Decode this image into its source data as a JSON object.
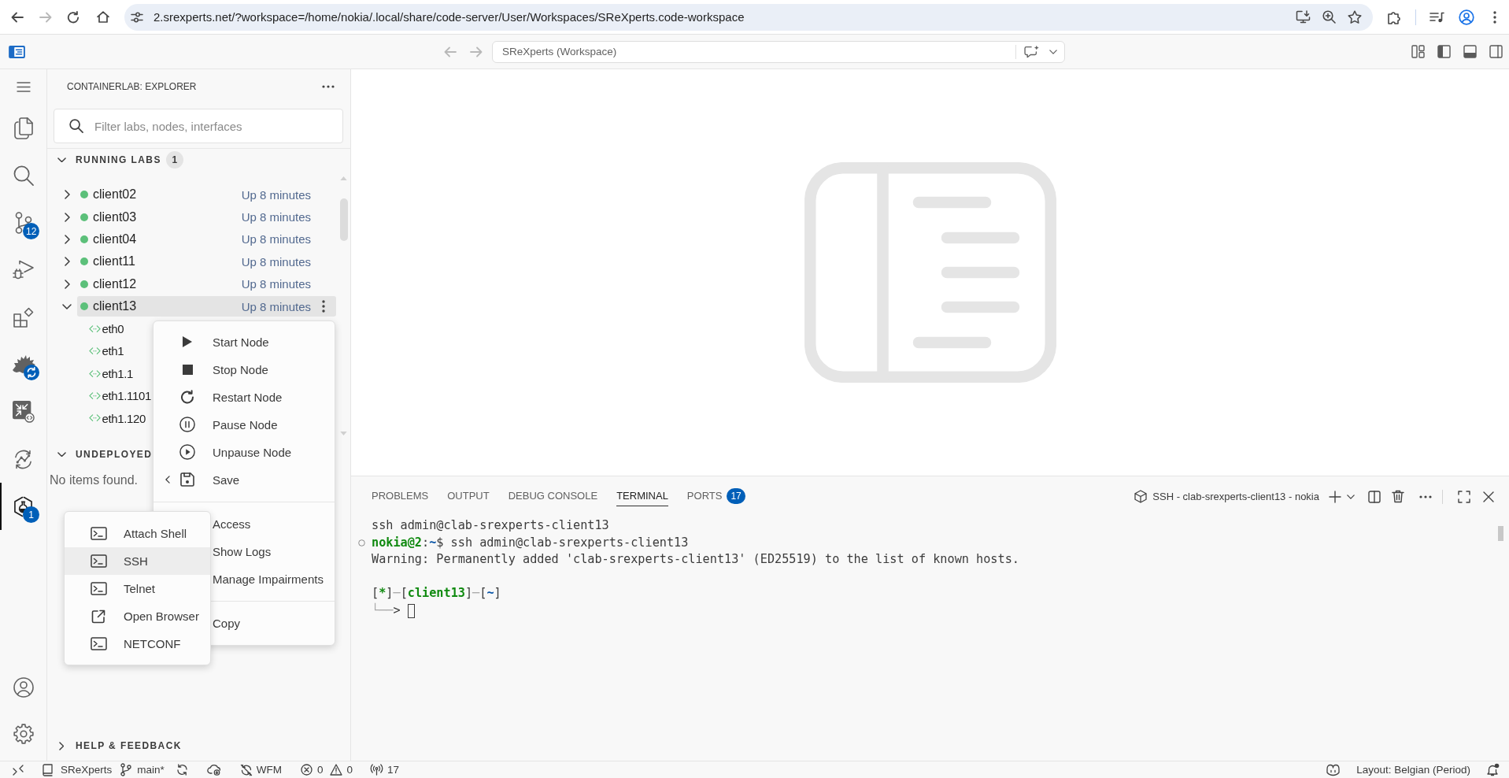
{
  "browser": {
    "back_disabled": false,
    "forward_disabled": true,
    "url": "2.srexperts.net/?workspace=/home/nokia/.local/share/code-server/User/Workspaces/SReXperts.code-workspace"
  },
  "title_bar": {
    "back_disabled": true,
    "forward_disabled": true,
    "command_center": "SReXperts (Workspace)"
  },
  "activity_bar": {
    "items": [
      {
        "selected": false
      },
      {
        "selected": false
      },
      {
        "badge": "12",
        "selected": false
      },
      {
        "selected": false
      },
      {
        "selected": false
      },
      {
        "selected": false
      },
      {
        "selected": false
      },
      {
        "selected": false
      },
      {
        "badge": "1",
        "selected": true
      }
    ]
  },
  "sidebar": {
    "title": "CONTAINERLAB: EXPLORER",
    "filter": {
      "placeholder": "Filter labs, nodes, interfaces"
    },
    "sections": [
      {
        "title": "RUNNING LABS",
        "count": "1",
        "expanded": true,
        "nodes": [
          {
            "name": "client02",
            "status": "Up 8 minutes",
            "running": true,
            "expanded": false,
            "selected": false
          },
          {
            "name": "client03",
            "status": "Up 8 minutes",
            "running": true,
            "expanded": false,
            "selected": false
          },
          {
            "name": "client04",
            "status": "Up 8 minutes",
            "running": true,
            "expanded": false,
            "selected": false
          },
          {
            "name": "client11",
            "status": "Up 8 minutes",
            "running": true,
            "expanded": false,
            "selected": false
          },
          {
            "name": "client12",
            "status": "Up 8 minutes",
            "running": true,
            "expanded": false,
            "selected": false
          },
          {
            "name": "client13",
            "status": "Up 8 minutes",
            "running": true,
            "expanded": true,
            "selected": true,
            "children": [
              {
                "name": "eth0"
              },
              {
                "name": "eth1"
              },
              {
                "name": "eth1.1"
              },
              {
                "name": "eth1.1101"
              },
              {
                "name": "eth1.120"
              }
            ]
          }
        ]
      },
      {
        "title": "UNDEPLOYED",
        "expanded": true,
        "empty_text": "No items found."
      },
      {
        "title": "HELP & FEEDBACK",
        "expanded": false
      }
    ]
  },
  "context_menu": {
    "groups": [
      [
        {
          "label": "Start Node",
          "submenu_arrow": false
        },
        {
          "label": "Stop Node",
          "submenu_arrow": false
        },
        {
          "label": "Restart Node",
          "submenu_arrow": false
        },
        {
          "label": "Pause Node",
          "submenu_arrow": false
        },
        {
          "label": "Unpause Node",
          "submenu_arrow": false
        },
        {
          "label": "Save",
          "submenu_arrow": true
        }
      ],
      [
        {
          "label": "Access",
          "submenu_arrow": false
        },
        {
          "label": "Show Logs",
          "submenu_arrow": false
        },
        {
          "label": "Manage Impairments",
          "submenu_arrow": false
        }
      ],
      [
        {
          "label": "Copy",
          "submenu_arrow": false
        }
      ]
    ]
  },
  "submenu": {
    "items": [
      {
        "label": "Attach Shell",
        "selected": false
      },
      {
        "label": "SSH",
        "selected": true
      },
      {
        "label": "Telnet",
        "selected": false
      },
      {
        "label": "Open Browser",
        "selected": false
      },
      {
        "label": "NETCONF",
        "selected": false
      }
    ]
  },
  "panel": {
    "tabs": [
      {
        "label": "PROBLEMS",
        "selected": false
      },
      {
        "label": "OUTPUT",
        "selected": false
      },
      {
        "label": "DEBUG CONSOLE",
        "selected": false
      },
      {
        "label": "TERMINAL",
        "selected": true
      },
      {
        "label": "PORTS",
        "badge": "17",
        "selected": false
      }
    ],
    "terminal_title": "SSH - clab-srexperts-client13 - nokia",
    "terminal": {
      "lines": [
        {
          "kind": "text",
          "decoration": false,
          "cursor": false,
          "segments": [
            {
              "text": "ssh admin@clab-srexperts-client13"
            }
          ]
        },
        {
          "kind": "text",
          "decoration": true,
          "cursor": false,
          "segments": [
            {
              "text": "nokia@2",
              "bold": true,
              "color": "#108a10"
            },
            {
              "text": ":"
            },
            {
              "text": "~",
              "bold": true,
              "color": "#0451a5"
            },
            {
              "text": "$ ssh admin@clab-srexperts-client13"
            }
          ]
        },
        {
          "kind": "text",
          "decoration": false,
          "cursor": false,
          "segments": [
            {
              "text": "Warning: Permanently added 'clab-srexperts-client13' (ED25519) to the list of known hosts."
            }
          ]
        },
        {
          "kind": "blank"
        },
        {
          "kind": "text",
          "decoration": false,
          "cursor": false,
          "segments": [
            {
              "text": "["
            },
            {
              "text": "*",
              "bold": true,
              "color": "#108a10"
            },
            {
              "text": "]"
            },
            {
              "text": "─",
              "color": "#a8a8a8"
            },
            {
              "text": "["
            },
            {
              "text": "client13",
              "bold": true,
              "color": "#108a10"
            },
            {
              "text": "]"
            },
            {
              "text": "─",
              "color": "#a8a8a8"
            },
            {
              "text": "["
            },
            {
              "text": "~",
              "bold": true,
              "color": "#0451a5"
            },
            {
              "text": "]"
            }
          ]
        },
        {
          "kind": "text",
          "decoration": false,
          "cursor": true,
          "segments": [
            {
              "text": "└──",
              "color": "#a8a8a8"
            },
            {
              "text": ">"
            }
          ]
        }
      ]
    }
  },
  "status_bar": {
    "workspace": "SReXperts",
    "branch": "main*",
    "profile": "WFM",
    "errors": "0",
    "warnings": "0",
    "ports": "17",
    "layout": "Layout: Belgian (Period)",
    "notifications_unread": true
  }
}
